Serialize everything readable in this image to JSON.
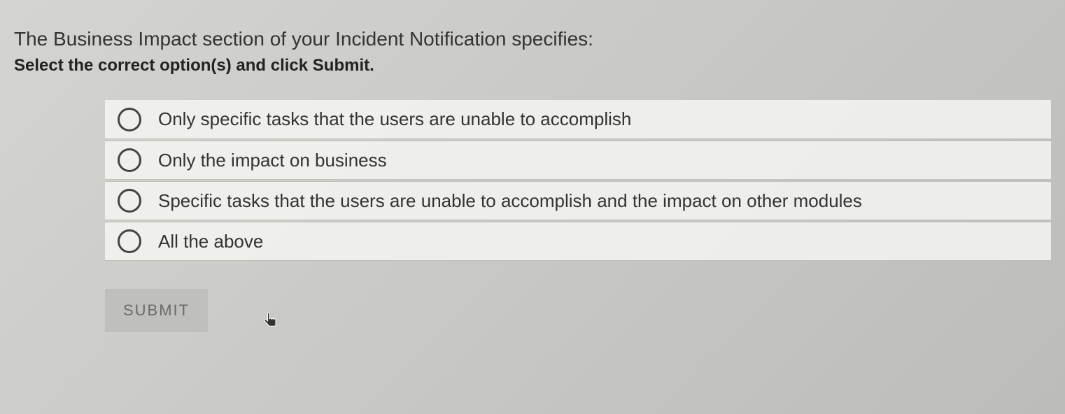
{
  "question": {
    "prompt": "The Business Impact section of your Incident Notification specifies:",
    "instruction": "Select the correct option(s) and click Submit."
  },
  "options": [
    {
      "label": "Only specific tasks that the users are unable to accomplish"
    },
    {
      "label": "Only the impact on business"
    },
    {
      "label": "Specific tasks that the users are unable to accomplish and the impact on other modules"
    },
    {
      "label": "All the above"
    }
  ],
  "submit_label": "SUBMIT"
}
